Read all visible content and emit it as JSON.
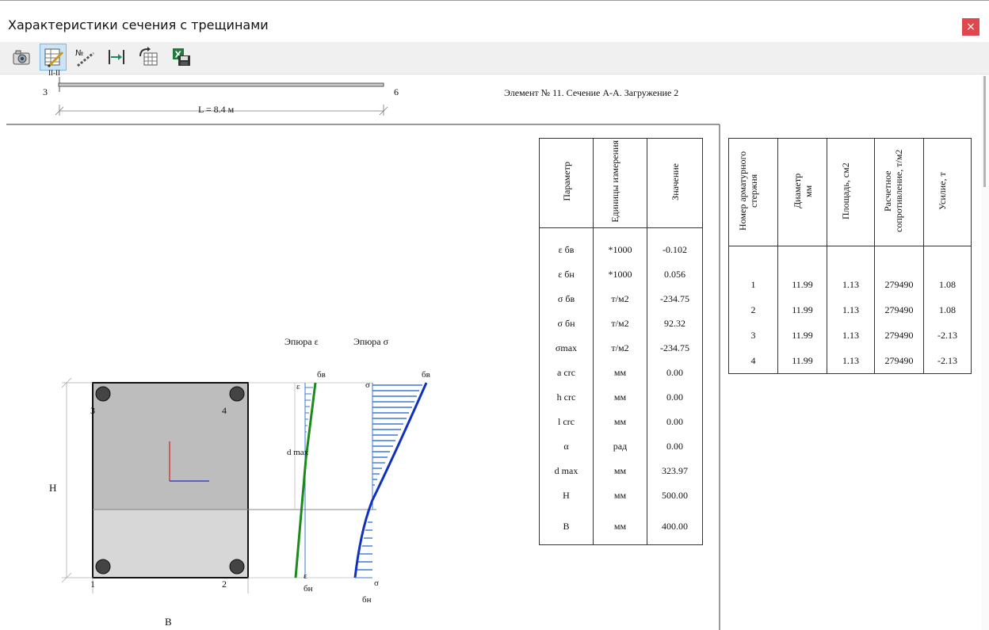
{
  "window": {
    "title": "Характеристики сечения с трещинами",
    "close_glyph": "×"
  },
  "toolbar": {
    "buttons": [
      {
        "icon": "camera-icon"
      },
      {
        "icon": "table-pencil-icon",
        "active": true
      },
      {
        "icon": "numbered-rebar-icon",
        "label": "№"
      },
      {
        "icon": "dimension-icon"
      },
      {
        "icon": "grid-rotate-icon"
      },
      {
        "icon": "excel-save-icon",
        "label": "X"
      }
    ]
  },
  "beam": {
    "section_mark": "II-II",
    "start_node": "3",
    "end_node": "6",
    "length_label": "L = 8.4 м"
  },
  "element_title": "Элемент № 11. Сечение А-А. Загружение 2",
  "section": {
    "height_label": "H",
    "width_label": "B",
    "rebars": [
      "1",
      "2",
      "3",
      "4"
    ],
    "epure_eps_title": "Эпюра ε",
    "epure_sigma_title": "Эпюра σ",
    "eps_top": "ε",
    "eps_bottom": "ε",
    "sigma_top": "σ",
    "sigma_bottom": "σ",
    "top_label": "бв",
    "bottom_label": "бн",
    "dmax_label": "d max"
  },
  "param_table": {
    "headers": [
      "Параметр",
      "Единицы измерения",
      "Значение"
    ],
    "rows": [
      {
        "param": "ε бв",
        "unit": "*1000",
        "value": "-0.102"
      },
      {
        "param": "ε бн",
        "unit": "*1000",
        "value": "0.056"
      },
      {
        "param": "σ бв",
        "unit": "т/м2",
        "value": "-234.75"
      },
      {
        "param": "σ бн",
        "unit": "т/м2",
        "value": "92.32"
      },
      {
        "param": "σmax",
        "unit": "т/м2",
        "value": "-234.75"
      },
      {
        "param": "a crc",
        "unit": "мм",
        "value": "0.00"
      },
      {
        "param": "h crc",
        "unit": "мм",
        "value": "0.00"
      },
      {
        "param": "l crc",
        "unit": "мм",
        "value": "0.00"
      },
      {
        "param": "α",
        "unit": "рад",
        "value": "0.00"
      },
      {
        "param": "d max",
        "unit": "мм",
        "value": "323.97"
      },
      {
        "param": "H",
        "unit": "мм",
        "value": "500.00"
      },
      {
        "param": "B",
        "unit": "мм",
        "value": "400.00"
      }
    ]
  },
  "rebar_table": {
    "headers": [
      "Номер арматурного стержня",
      "Диаметр мм",
      "Площадь, см2",
      "Расчетное сопротивление, т/м2",
      "Усилие, т"
    ],
    "rows": [
      [
        "1",
        "11.99",
        "1.13",
        "279490",
        "1.08"
      ],
      [
        "2",
        "11.99",
        "1.13",
        "279490",
        "1.08"
      ],
      [
        "3",
        "11.99",
        "1.13",
        "279490",
        "-2.13"
      ],
      [
        "4",
        "11.99",
        "1.13",
        "279490",
        "-2.13"
      ]
    ]
  },
  "colors": {
    "eps_line": "#1a8a1a",
    "sigma_line": "#1030c0",
    "hatch": "#3a78d8",
    "close_btn": "#e0474c"
  }
}
